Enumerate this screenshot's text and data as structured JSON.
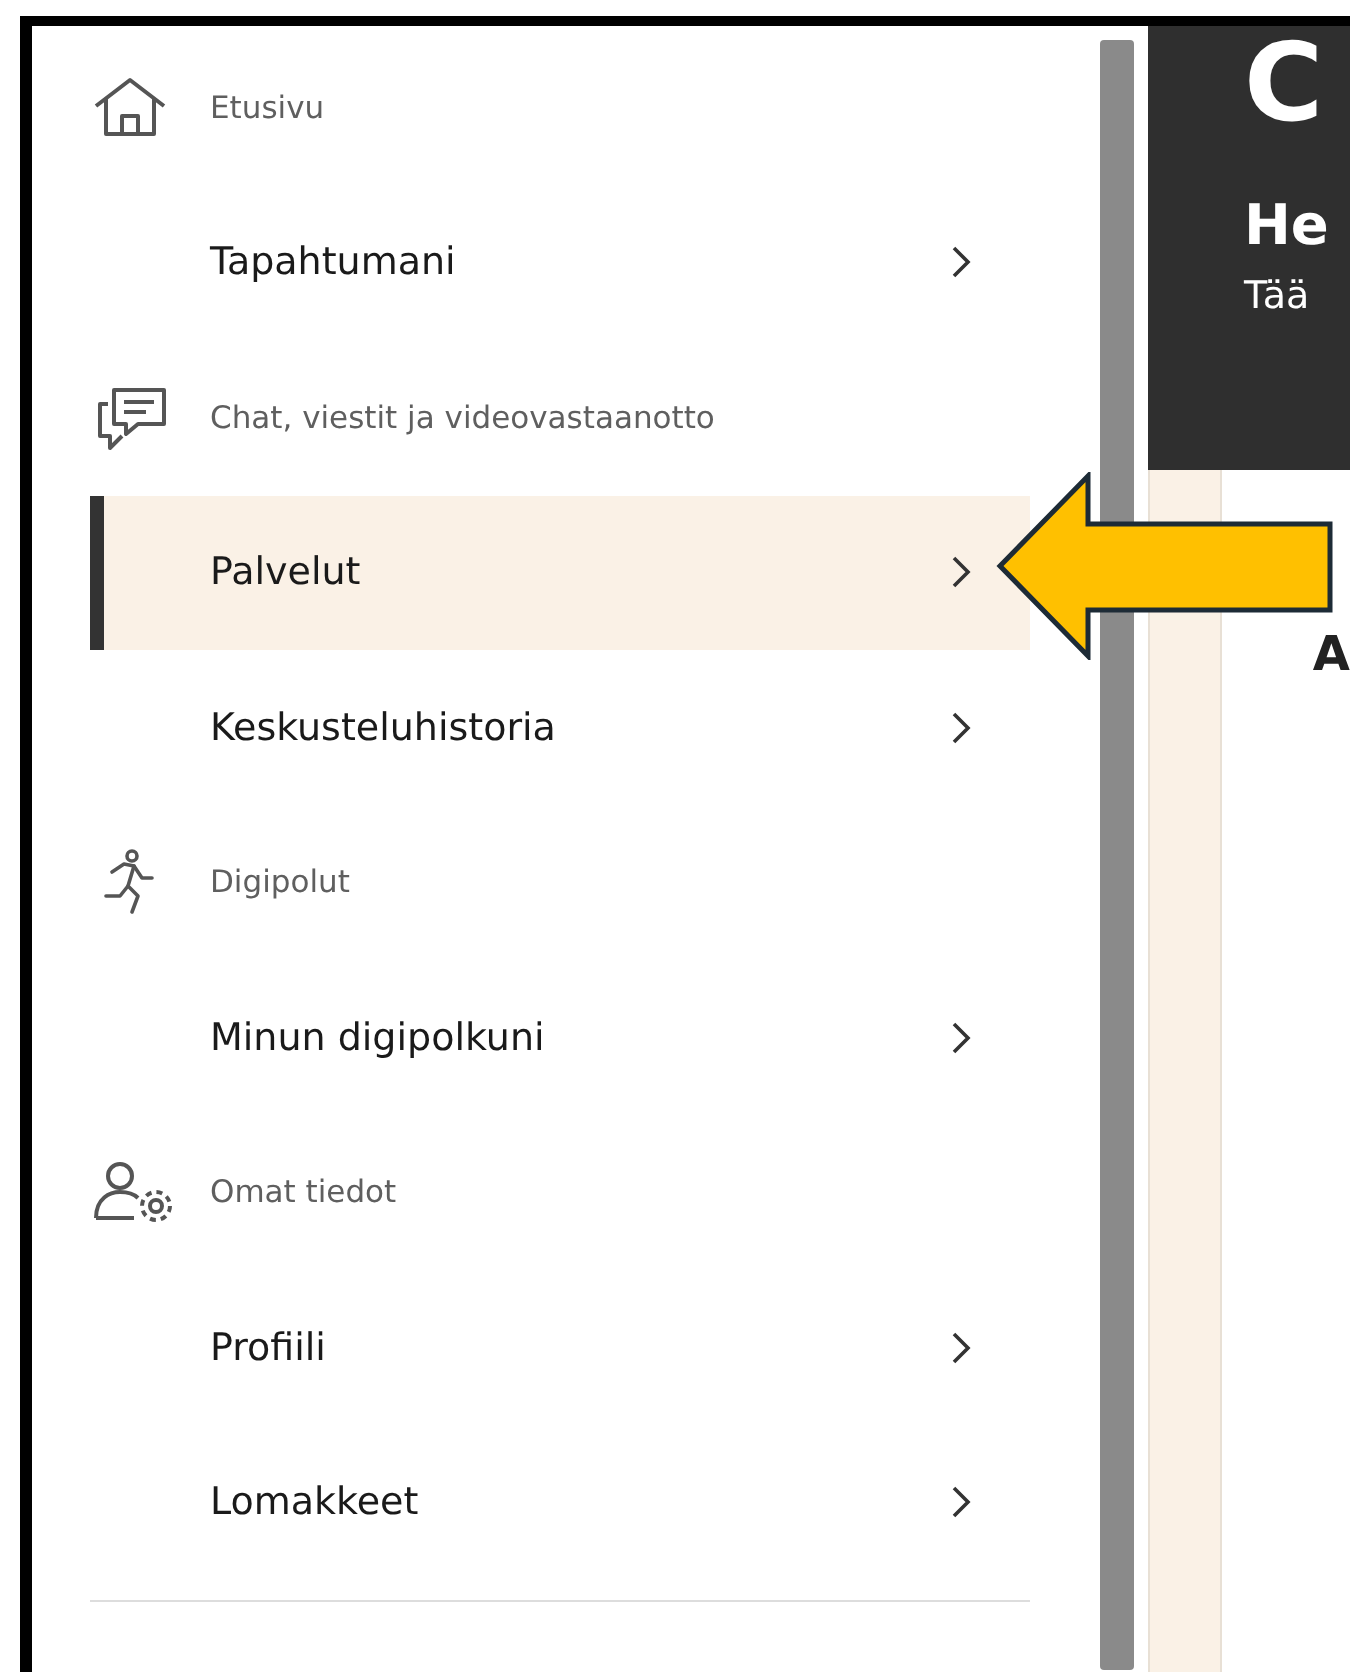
{
  "sidebar": {
    "items": [
      {
        "kind": "header",
        "label": "Etusivu",
        "selected": false
      },
      {
        "kind": "link",
        "label": "Tapahtumani",
        "selected": false
      },
      {
        "kind": "header",
        "label": "Chat, viestit ja videovastaanotto",
        "selected": false
      },
      {
        "kind": "link",
        "label": "Palvelut",
        "selected": true
      },
      {
        "kind": "link",
        "label": "Keskusteluhistoria",
        "selected": false
      },
      {
        "kind": "header",
        "label": "Digipolut",
        "selected": false
      },
      {
        "kind": "link",
        "label": "Minun digipolkuni",
        "selected": false
      },
      {
        "kind": "header",
        "label": "Omat tiedot",
        "selected": false
      },
      {
        "kind": "link",
        "label": "Profiili",
        "selected": false
      },
      {
        "kind": "link",
        "label": "Lomakkeet",
        "selected": false
      }
    ]
  },
  "content": {
    "title": "C",
    "heading": "He",
    "text": "Tää",
    "card_heading": "A"
  }
}
